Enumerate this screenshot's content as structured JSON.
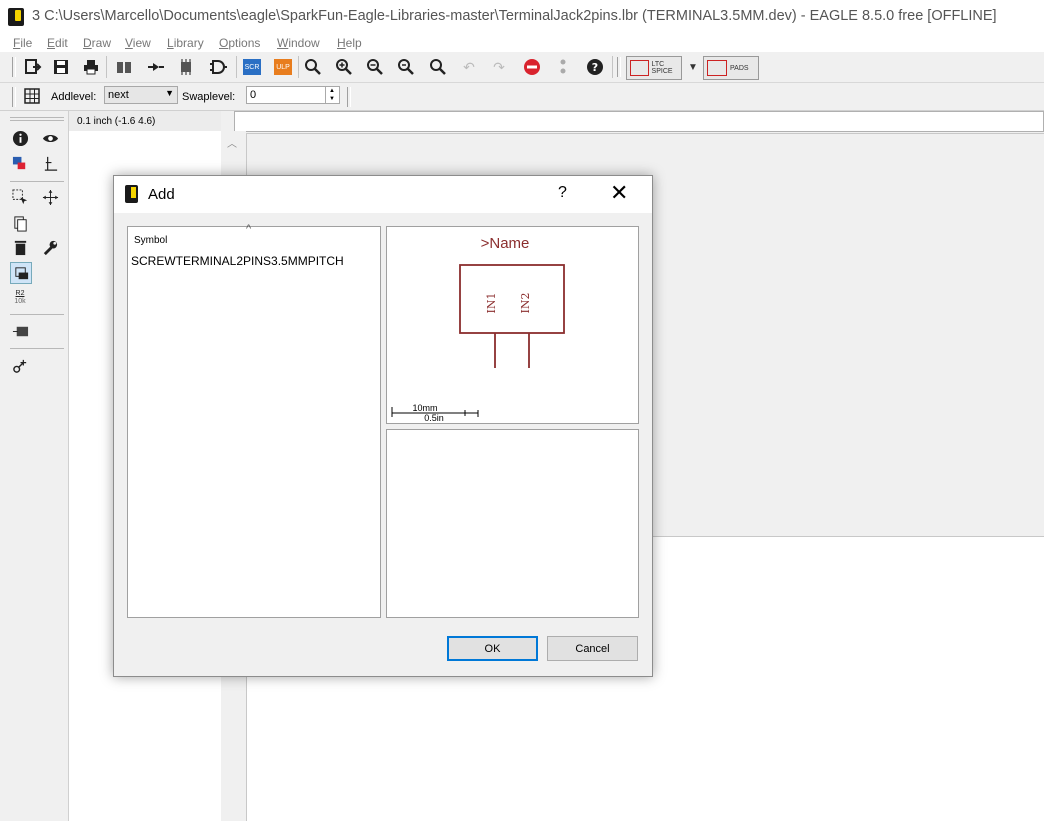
{
  "window": {
    "title": "3 C:\\Users\\Marcello\\Documents\\eagle\\SparkFun-Eagle-Libraries-master\\TerminalJack2pins.lbr (TERMINAL3.5MM.dev) - EAGLE 8.5.0 free [OFFLINE]"
  },
  "menu": [
    "File",
    "Edit",
    "Draw",
    "View",
    "Library",
    "Options",
    "Window",
    "Help"
  ],
  "toolbar": {
    "ltspice_label": "LTC SPICE",
    "pads_label": "PADS",
    "scr_label": "SCR",
    "ulp_label": "ULP"
  },
  "toolbar2": {
    "addlevel_label": "Addlevel:",
    "addlevel_value": "next",
    "swaplevel_label": "Swaplevel:",
    "swaplevel_value": "0"
  },
  "palette": {
    "value_top": "R2",
    "value_bottom": "10k"
  },
  "coordinate": "0.1 inch (-1.6 4.6)",
  "dialog": {
    "title": "Add",
    "help": "?",
    "close": "✕",
    "list_header": "Symbol",
    "items": [
      "SCREWTERMINAL2PINS3.5MMPITCH"
    ],
    "preview": {
      "name_text": ">Name",
      "pin1": "IN1",
      "pin2": "IN2",
      "scale_mm": "10mm",
      "scale_in": "0.5in",
      "color": "#8b2e2e"
    },
    "ok_label": "OK",
    "cancel_label": "Cancel"
  },
  "colors": {
    "accent": "#0078d7",
    "symbol": "#8b2e2e"
  }
}
